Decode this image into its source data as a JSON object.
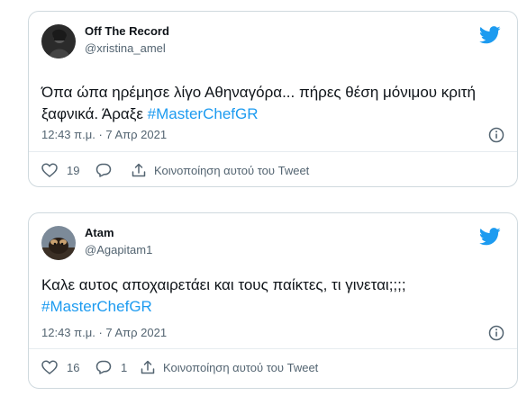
{
  "colors": {
    "accent": "#1d9bf0",
    "text": "#0f1419",
    "muted": "#536471",
    "border": "#cfd9de"
  },
  "tweets": [
    {
      "author_name": "Off The Record",
      "author_handle": "@xristina_amel",
      "text": "Όπα ώπα ηρέμησε λίγο Αθηναγόρα... πήρες θέση μόνιμου κριτή ξαφνικά. Άραξε ",
      "hashtag": "#MasterChefGR",
      "timestamp": "12:43 π.μ. · 7 Απρ 2021",
      "likes": "19",
      "replies": "",
      "share_label": "Κοινοποίηση αυτού του Tweet",
      "icons": [
        "twitter-bird-icon",
        "info-icon",
        "heart-icon",
        "reply-icon",
        "share-icon"
      ]
    },
    {
      "author_name": "Atam",
      "author_handle": "@Agapitam1",
      "text": "Καλε αυτος αποχαιρετάει και τους παίκτες, τι γινεται;;;; ",
      "hashtag": "#MasterChefGR",
      "timestamp": "12:43 π.μ. · 7 Απρ 2021",
      "likes": "16",
      "replies": "1",
      "share_label": "Κοινοποίηση αυτού του Tweet",
      "icons": [
        "twitter-bird-icon",
        "info-icon",
        "heart-icon",
        "reply-icon",
        "share-icon"
      ]
    }
  ]
}
